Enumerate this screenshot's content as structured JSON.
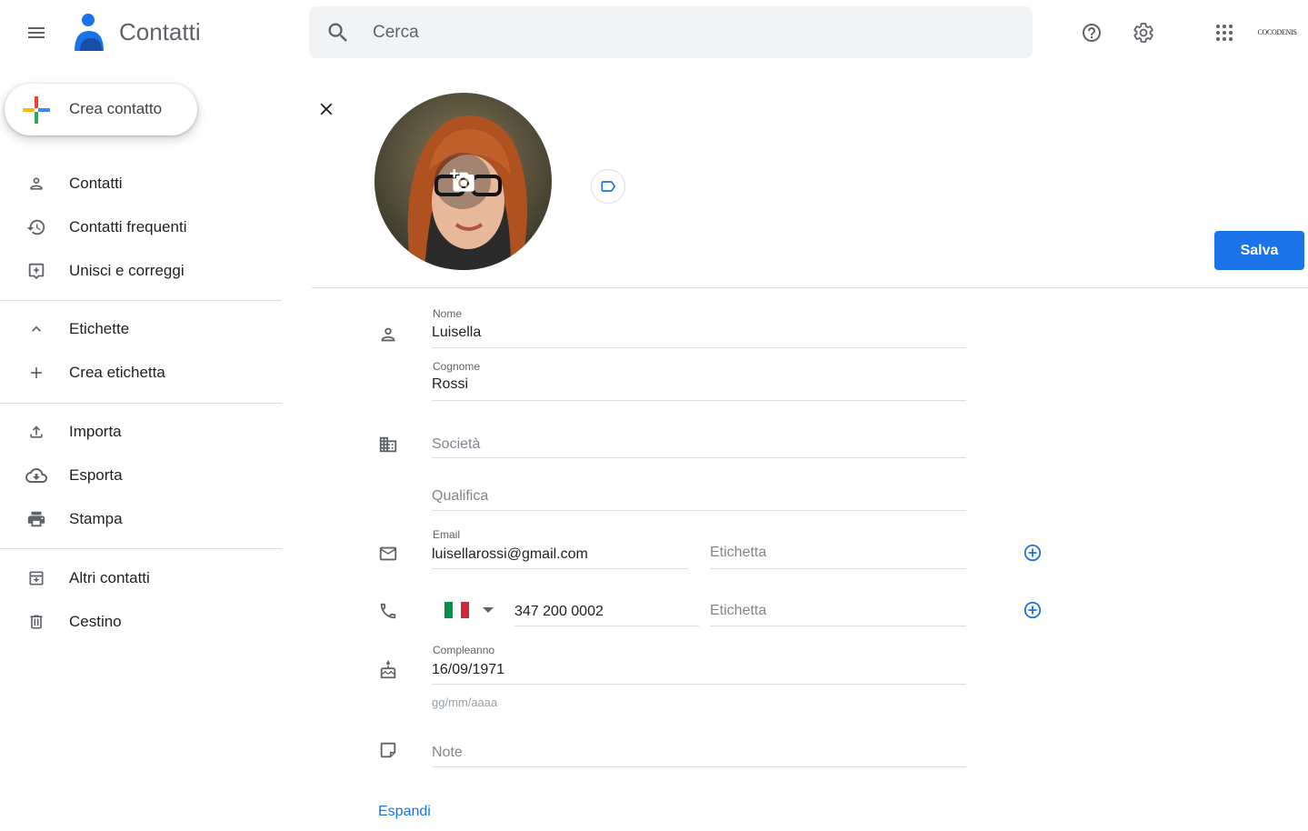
{
  "header": {
    "app_title": "Contatti",
    "search_placeholder": "Cerca",
    "brand_text": "COCODENIS"
  },
  "sidebar": {
    "create_label": "Crea contatto",
    "items": [
      {
        "label": "Contatti",
        "icon": "person-icon"
      },
      {
        "label": "Contatti frequenti",
        "icon": "history-icon"
      },
      {
        "label": "Unisci e correggi",
        "icon": "merge-icon"
      }
    ],
    "labels_section": {
      "label": "Etichette",
      "icon": "chevron-up-icon"
    },
    "create_label_item": {
      "label": "Crea etichetta",
      "icon": "plus-icon"
    },
    "tools": [
      {
        "label": "Importa",
        "icon": "upload-icon"
      },
      {
        "label": "Esporta",
        "icon": "cloud-download-icon"
      },
      {
        "label": "Stampa",
        "icon": "printer-icon"
      }
    ],
    "other": [
      {
        "label": "Altri contatti",
        "icon": "archive-icon"
      },
      {
        "label": "Cestino",
        "icon": "trash-icon"
      }
    ]
  },
  "editor": {
    "save_label": "Salva",
    "name": {
      "label": "Nome",
      "value": "Luisella"
    },
    "surname": {
      "label": "Cognome",
      "value": "Rossi"
    },
    "company": {
      "placeholder": "Società"
    },
    "job_title": {
      "placeholder": "Qualifica"
    },
    "email": {
      "label": "Email",
      "value": "luisellarossi@gmail.com",
      "tag_placeholder": "Etichetta"
    },
    "phone": {
      "value": "347 200 0002",
      "country": "Italy",
      "tag_placeholder": "Etichetta"
    },
    "birthday": {
      "label": "Compleanno",
      "value": "16/09/1971",
      "hint": "gg/mm/aaaa"
    },
    "notes": {
      "placeholder": "Note"
    },
    "expand_label": "Espandi"
  },
  "colors": {
    "accent": "#1a73e8",
    "icon_gray": "#5f6368",
    "divider": "#dadce0",
    "flag_green": "#009246",
    "flag_white": "#ffffff",
    "flag_red": "#ce2b37"
  }
}
